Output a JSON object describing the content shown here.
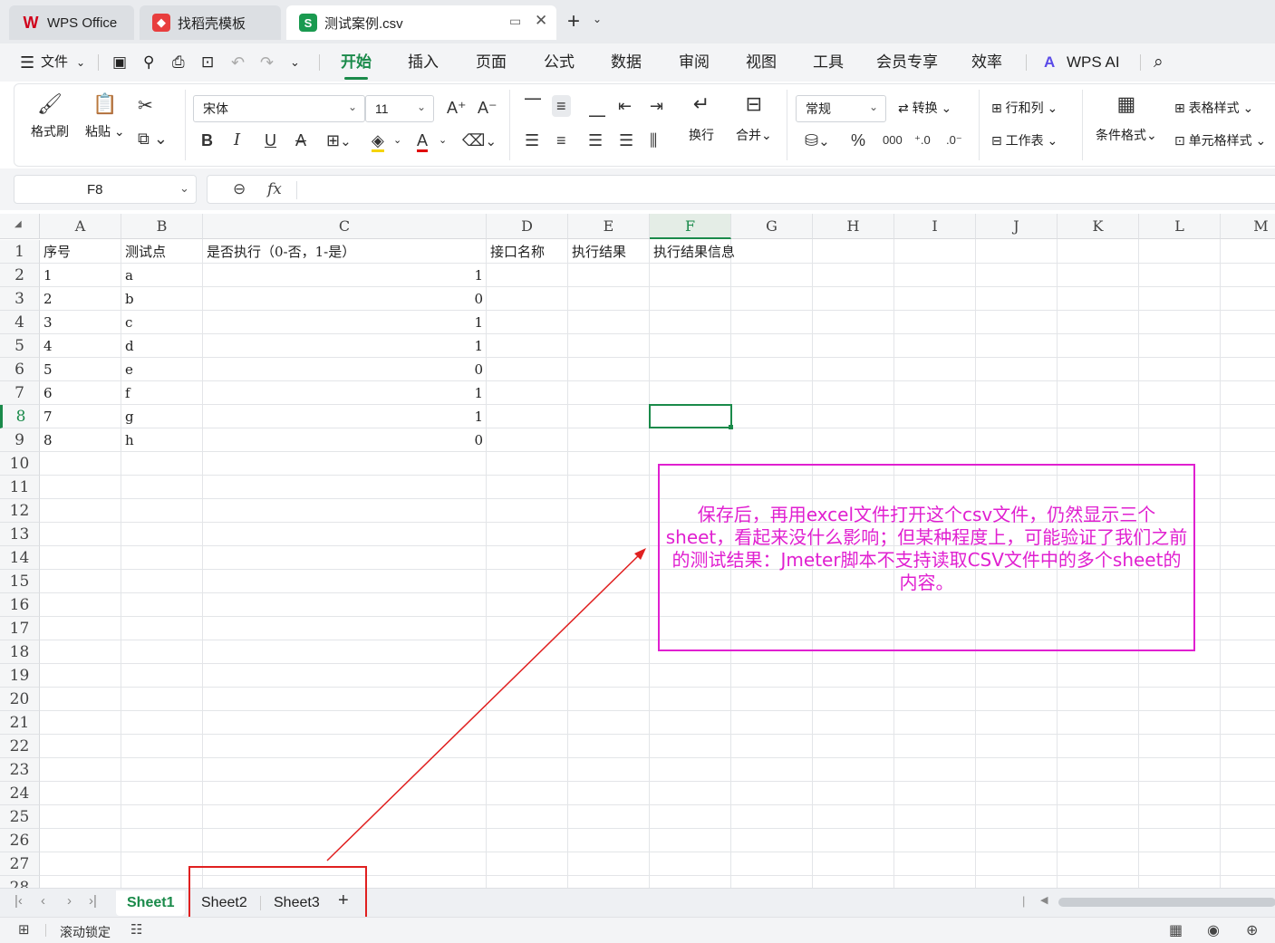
{
  "tabs": [
    {
      "label": "WPS Office",
      "icon": "wps-logo-icon"
    },
    {
      "label": "找稻壳模板",
      "icon": "docer-icon"
    },
    {
      "label": "测试案例.csv",
      "icon": "spreadsheet-icon",
      "active": true
    }
  ],
  "menu": {
    "file": "文件",
    "items": [
      "开始",
      "插入",
      "页面",
      "公式",
      "数据",
      "审阅",
      "视图",
      "工具",
      "会员专享",
      "效率"
    ],
    "ai": "WPS AI"
  },
  "ribbon": {
    "format_painter": "格式刷",
    "paste": "粘贴",
    "font_name": "宋体",
    "font_size": "11",
    "wrap": "换行",
    "merge": "合并",
    "number_format": "常规",
    "convert": "转换",
    "rows_cols": "行和列",
    "worksheet": "工作表",
    "cond_format": "条件格式",
    "table_style": "表格样式",
    "cell_style": "单元格样式",
    "accent": "#1a8a4a"
  },
  "formula_bar": {
    "cell_ref": "F8",
    "fx": "fx",
    "value": ""
  },
  "columns": [
    "A",
    "B",
    "C",
    "D",
    "E",
    "F",
    "G",
    "H",
    "I",
    "J",
    "K",
    "L",
    "M"
  ],
  "selected_column": "F",
  "selected_row": 8,
  "rows": [
    [
      "序号",
      "测试点",
      "是否执行（0-否，1-是）",
      "接口名称",
      "执行结果",
      "执行结果信息"
    ],
    [
      "1",
      "a",
      "1",
      "",
      "",
      ""
    ],
    [
      "2",
      "b",
      "0",
      "",
      "",
      ""
    ],
    [
      "3",
      "c",
      "1",
      "",
      "",
      ""
    ],
    [
      "4",
      "d",
      "1",
      "",
      "",
      ""
    ],
    [
      "5",
      "e",
      "0",
      "",
      "",
      ""
    ],
    [
      "6",
      "f",
      "1",
      "",
      "",
      ""
    ],
    [
      "7",
      "g",
      "1",
      "",
      "",
      ""
    ],
    [
      "8",
      "h",
      "0",
      "",
      "",
      ""
    ]
  ],
  "row_count": 28,
  "sheets": [
    "Sheet1",
    "Sheet2",
    "Sheet3"
  ],
  "active_sheet": "Sheet1",
  "status": {
    "scroll_lock": "滚动锁定"
  },
  "annotation": {
    "text": "保存后，再用excel文件打开这个csv文件，仍然显示三个sheet，看起来没什么影响；但某种程度上，可能验证了我们之前的测试结果：Jmeter脚本不支持读取CSV文件中的多个sheet的内容。",
    "color": "#e020d0",
    "arrow_color": "#e02020"
  }
}
